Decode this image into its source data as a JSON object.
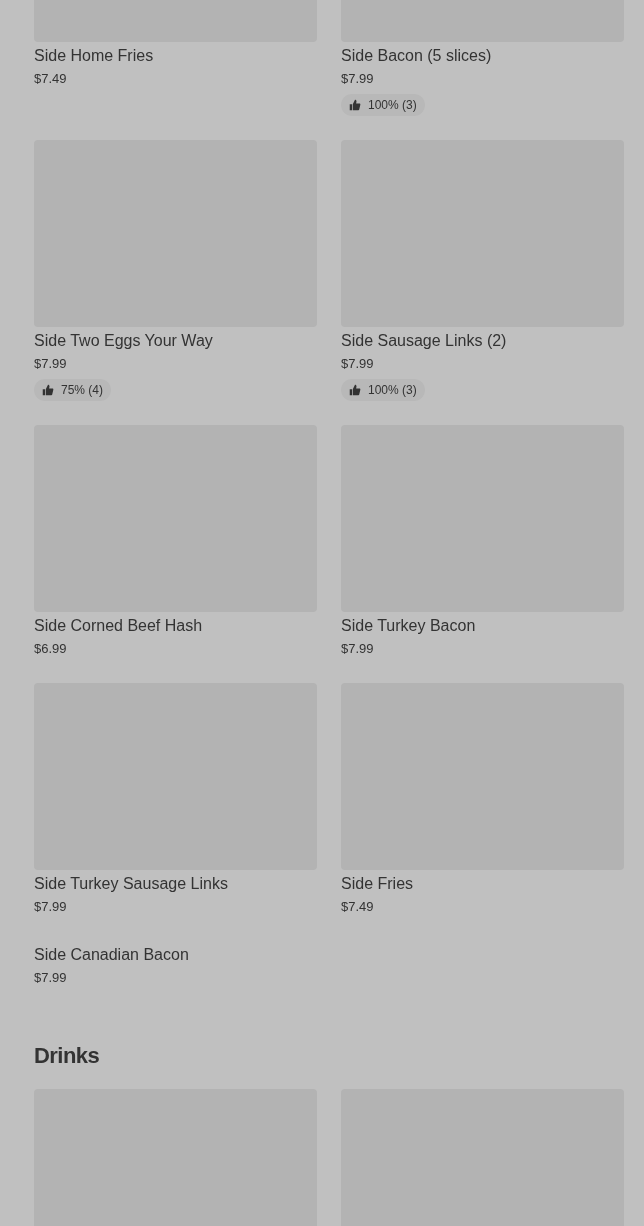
{
  "sections": [
    {
      "items": [
        {
          "name": "Side Home Fries",
          "price": "$7.49",
          "has_image": true
        },
        {
          "name": "Side Bacon (5 slices)",
          "price": "$7.99",
          "has_image": true,
          "rating": "100% (3)"
        },
        {
          "name": "Side Two Eggs Your Way",
          "price": "$7.99",
          "has_image": true,
          "rating": "75% (4)"
        },
        {
          "name": "Side Sausage Links (2)",
          "price": "$7.99",
          "has_image": true,
          "rating": "100% (3)"
        },
        {
          "name": "Side Corned Beef Hash",
          "price": "$6.99",
          "has_image": true
        },
        {
          "name": "Side Turkey Bacon",
          "price": "$7.99",
          "has_image": true
        },
        {
          "name": "Side Turkey Sausage Links",
          "price": "$7.99",
          "has_image": true
        },
        {
          "name": "Side Fries",
          "price": "$7.49",
          "has_image": true
        },
        {
          "name": "Side Canadian Bacon",
          "price": "$7.99",
          "has_image": false
        }
      ]
    },
    {
      "title": "Drinks",
      "items": [
        {
          "has_image": true
        },
        {
          "has_image": true
        }
      ]
    }
  ]
}
